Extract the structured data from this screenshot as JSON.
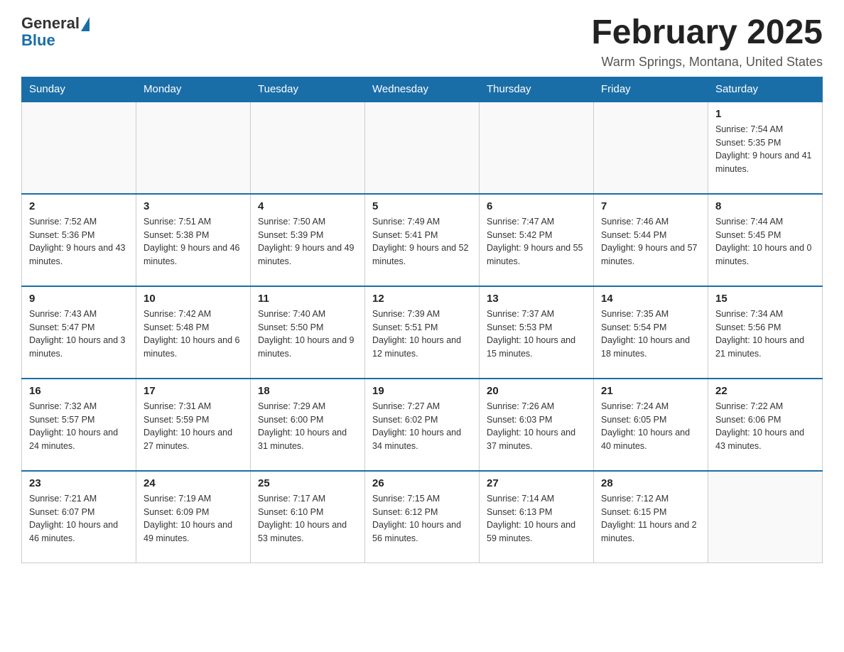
{
  "logo": {
    "general": "General",
    "blue": "Blue"
  },
  "title": "February 2025",
  "location": "Warm Springs, Montana, United States",
  "days_of_week": [
    "Sunday",
    "Monday",
    "Tuesday",
    "Wednesday",
    "Thursday",
    "Friday",
    "Saturday"
  ],
  "weeks": [
    [
      {
        "day": "",
        "info": ""
      },
      {
        "day": "",
        "info": ""
      },
      {
        "day": "",
        "info": ""
      },
      {
        "day": "",
        "info": ""
      },
      {
        "day": "",
        "info": ""
      },
      {
        "day": "",
        "info": ""
      },
      {
        "day": "1",
        "info": "Sunrise: 7:54 AM\nSunset: 5:35 PM\nDaylight: 9 hours and 41 minutes."
      }
    ],
    [
      {
        "day": "2",
        "info": "Sunrise: 7:52 AM\nSunset: 5:36 PM\nDaylight: 9 hours and 43 minutes."
      },
      {
        "day": "3",
        "info": "Sunrise: 7:51 AM\nSunset: 5:38 PM\nDaylight: 9 hours and 46 minutes."
      },
      {
        "day": "4",
        "info": "Sunrise: 7:50 AM\nSunset: 5:39 PM\nDaylight: 9 hours and 49 minutes."
      },
      {
        "day": "5",
        "info": "Sunrise: 7:49 AM\nSunset: 5:41 PM\nDaylight: 9 hours and 52 minutes."
      },
      {
        "day": "6",
        "info": "Sunrise: 7:47 AM\nSunset: 5:42 PM\nDaylight: 9 hours and 55 minutes."
      },
      {
        "day": "7",
        "info": "Sunrise: 7:46 AM\nSunset: 5:44 PM\nDaylight: 9 hours and 57 minutes."
      },
      {
        "day": "8",
        "info": "Sunrise: 7:44 AM\nSunset: 5:45 PM\nDaylight: 10 hours and 0 minutes."
      }
    ],
    [
      {
        "day": "9",
        "info": "Sunrise: 7:43 AM\nSunset: 5:47 PM\nDaylight: 10 hours and 3 minutes."
      },
      {
        "day": "10",
        "info": "Sunrise: 7:42 AM\nSunset: 5:48 PM\nDaylight: 10 hours and 6 minutes."
      },
      {
        "day": "11",
        "info": "Sunrise: 7:40 AM\nSunset: 5:50 PM\nDaylight: 10 hours and 9 minutes."
      },
      {
        "day": "12",
        "info": "Sunrise: 7:39 AM\nSunset: 5:51 PM\nDaylight: 10 hours and 12 minutes."
      },
      {
        "day": "13",
        "info": "Sunrise: 7:37 AM\nSunset: 5:53 PM\nDaylight: 10 hours and 15 minutes."
      },
      {
        "day": "14",
        "info": "Sunrise: 7:35 AM\nSunset: 5:54 PM\nDaylight: 10 hours and 18 minutes."
      },
      {
        "day": "15",
        "info": "Sunrise: 7:34 AM\nSunset: 5:56 PM\nDaylight: 10 hours and 21 minutes."
      }
    ],
    [
      {
        "day": "16",
        "info": "Sunrise: 7:32 AM\nSunset: 5:57 PM\nDaylight: 10 hours and 24 minutes."
      },
      {
        "day": "17",
        "info": "Sunrise: 7:31 AM\nSunset: 5:59 PM\nDaylight: 10 hours and 27 minutes."
      },
      {
        "day": "18",
        "info": "Sunrise: 7:29 AM\nSunset: 6:00 PM\nDaylight: 10 hours and 31 minutes."
      },
      {
        "day": "19",
        "info": "Sunrise: 7:27 AM\nSunset: 6:02 PM\nDaylight: 10 hours and 34 minutes."
      },
      {
        "day": "20",
        "info": "Sunrise: 7:26 AM\nSunset: 6:03 PM\nDaylight: 10 hours and 37 minutes."
      },
      {
        "day": "21",
        "info": "Sunrise: 7:24 AM\nSunset: 6:05 PM\nDaylight: 10 hours and 40 minutes."
      },
      {
        "day": "22",
        "info": "Sunrise: 7:22 AM\nSunset: 6:06 PM\nDaylight: 10 hours and 43 minutes."
      }
    ],
    [
      {
        "day": "23",
        "info": "Sunrise: 7:21 AM\nSunset: 6:07 PM\nDaylight: 10 hours and 46 minutes."
      },
      {
        "day": "24",
        "info": "Sunrise: 7:19 AM\nSunset: 6:09 PM\nDaylight: 10 hours and 49 minutes."
      },
      {
        "day": "25",
        "info": "Sunrise: 7:17 AM\nSunset: 6:10 PM\nDaylight: 10 hours and 53 minutes."
      },
      {
        "day": "26",
        "info": "Sunrise: 7:15 AM\nSunset: 6:12 PM\nDaylight: 10 hours and 56 minutes."
      },
      {
        "day": "27",
        "info": "Sunrise: 7:14 AM\nSunset: 6:13 PM\nDaylight: 10 hours and 59 minutes."
      },
      {
        "day": "28",
        "info": "Sunrise: 7:12 AM\nSunset: 6:15 PM\nDaylight: 11 hours and 2 minutes."
      },
      {
        "day": "",
        "info": ""
      }
    ]
  ]
}
